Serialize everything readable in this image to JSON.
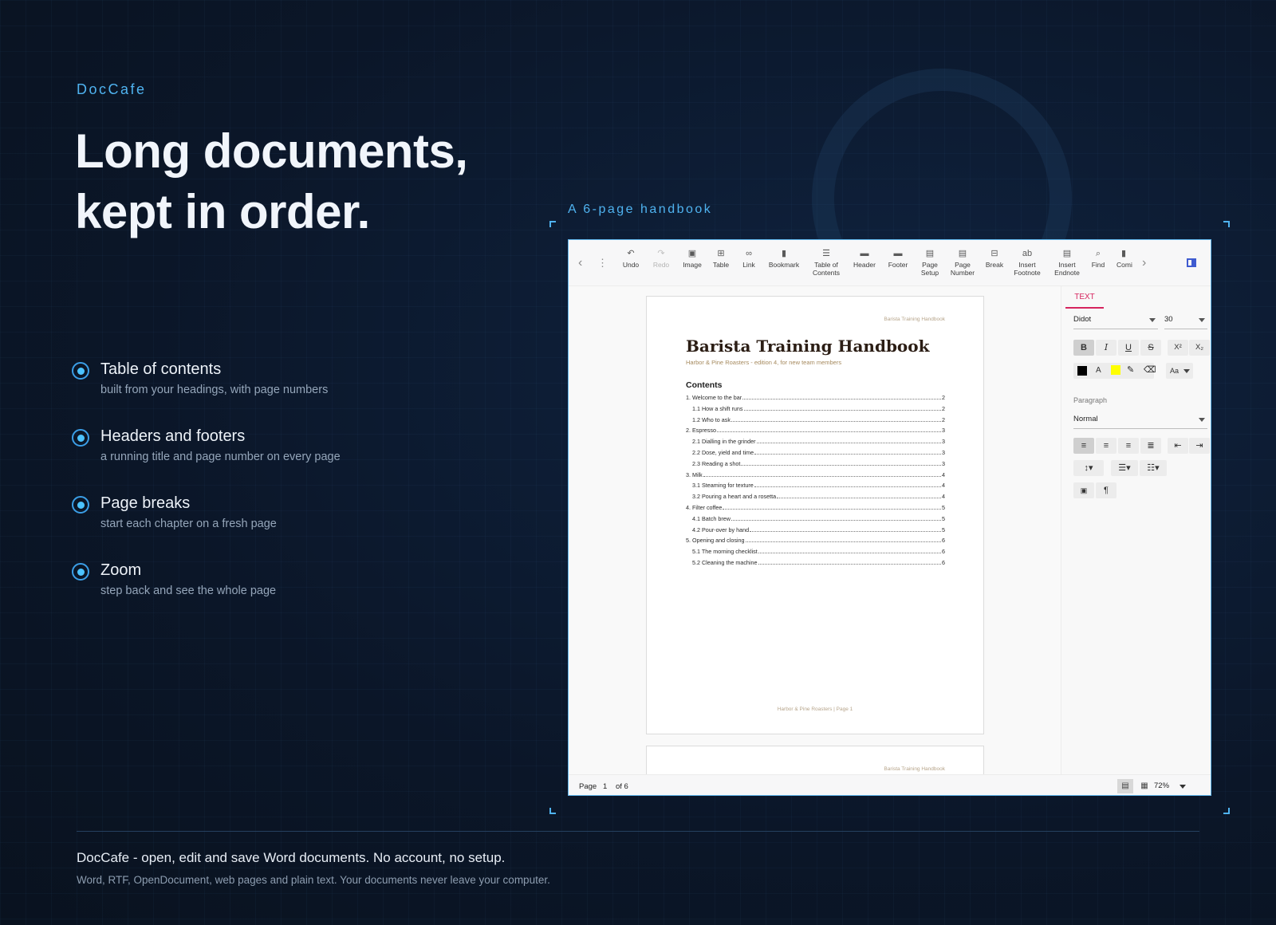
{
  "brand": "DocCafe",
  "headline": [
    "Long documents,",
    "kept in order."
  ],
  "features": [
    {
      "title": "Table of contents",
      "desc": "built from your headings, with page numbers"
    },
    {
      "title": "Headers and footers",
      "desc": "a running title and page number on every page"
    },
    {
      "title": "Page breaks",
      "desc": "start each chapter on a fresh page"
    },
    {
      "title": "Zoom",
      "desc": "step back and see the whole page"
    }
  ],
  "caption": "A 6-page handbook",
  "toolbar": {
    "undo": "Undo",
    "redo": "Redo",
    "image": "Image",
    "table": "Table",
    "link": "Link",
    "bookmark": "Bookmark",
    "toc_1": "Table of",
    "toc_2": "Contents",
    "header": "Header",
    "footer": "Footer",
    "pagesetup_1": "Page",
    "pagesetup_2": "Setup",
    "pagenumber_1": "Page",
    "pagenumber_2": "Number",
    "break": "Break",
    "footnote_1": "Insert",
    "footnote_2": "Footnote",
    "endnote_1": "Insert",
    "endnote_2": "Endnote",
    "find": "Find",
    "comment": "Comi"
  },
  "icons": {
    "back": "chevron-left-icon",
    "more": "more-vertical-icon",
    "forward": "chevron-right-icon",
    "panel": "sidebar-panel-icon"
  },
  "document": {
    "running_head": "Barista Training Handbook",
    "title": "Barista Training Handbook",
    "subtitle": "Harbor & Pine Roasters - edition 4, for new team members",
    "toc_heading": "Contents",
    "toc": [
      {
        "text": "1. Welcome to the bar",
        "page": "2",
        "level": 1
      },
      {
        "text": "1.1 How a shift runs",
        "page": "2",
        "level": 2
      },
      {
        "text": "1.2 Who to ask",
        "page": "2",
        "level": 2
      },
      {
        "text": "2. Espresso",
        "page": "3",
        "level": 1
      },
      {
        "text": "2.1 Dialling in the grinder",
        "page": "3",
        "level": 2
      },
      {
        "text": "2.2 Dose, yield and time",
        "page": "3",
        "level": 2
      },
      {
        "text": "2.3 Reading a shot",
        "page": "3",
        "level": 2
      },
      {
        "text": "3. Milk",
        "page": "4",
        "level": 1
      },
      {
        "text": "3.1 Steaming for texture",
        "page": "4",
        "level": 2
      },
      {
        "text": "3.2 Pouring a heart and a rosetta",
        "page": "4",
        "level": 2
      },
      {
        "text": "4. Filter coffee",
        "page": "5",
        "level": 1
      },
      {
        "text": "4.1 Batch brew",
        "page": "5",
        "level": 2
      },
      {
        "text": "4.2 Pour-over by hand",
        "page": "5",
        "level": 2
      },
      {
        "text": "5. Opening and closing",
        "page": "6",
        "level": 1
      },
      {
        "text": "5.1 The morning checklist",
        "page": "6",
        "level": 2
      },
      {
        "text": "5.2 Cleaning the machine",
        "page": "6",
        "level": 2
      }
    ],
    "footer": "Harbor & Pine Roasters  |  Page 1",
    "page2_running_head": "Barista Training Handbook"
  },
  "sidebar": {
    "tab": "TEXT",
    "font": "Didot",
    "size": "30",
    "bold": "B",
    "italic": "I",
    "underline": "U",
    "strike": "S",
    "superscript": "X²",
    "subscript": "X₂",
    "font_color": "#000000",
    "highlight_color": "#ffff00",
    "font_color_label": "A",
    "case_label": "Aa",
    "paragraph_label": "Paragraph",
    "paragraph_style": "Normal",
    "pilcrow": "¶"
  },
  "statusbar": {
    "page_label": "Page",
    "page_value": "1",
    "of_label": "of 6",
    "zoom": "72%"
  },
  "footer": {
    "title": "DocCafe - open, edit and save Word documents. No account, no setup.",
    "subtitle": "Word, RTF, OpenDocument, web pages and plain text. Your documents never leave your computer."
  },
  "colors": {
    "accent": "#4fb3f0",
    "background": "#0b1628",
    "tab_active": "#d6245e",
    "doc_meta": "#b6a48a"
  }
}
